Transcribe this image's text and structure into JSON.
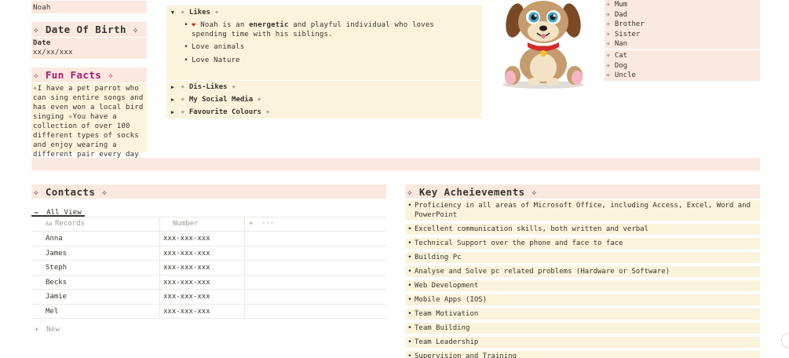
{
  "profile": {
    "name_value": "Noah",
    "dob_heading": "✧ Date Of Birth ✧",
    "dob_label": "Date",
    "dob_value": "xx/xx/xxx",
    "fun_heading": "✧ Fun Facts ✧",
    "fun_text": "✧I have a pet parrot who can sing entire songs and has even won a local bird singing ✧You have a collection of over 100 different types of socks and enjoy wearing a different pair every day"
  },
  "toggles": {
    "likes": "✧ Likes ✧",
    "likes_items": {
      "heart_icon": "❤",
      "intro_before": "Noah is an ",
      "intro_bold": "energetic",
      "intro_after": " and playful individual who loves spending time with his siblings.",
      "item2": "Love animals",
      "item3": "Love Nature"
    },
    "dislikes": "✧ Dis-Likes ✧",
    "social": "✧ My Social Media ✧",
    "colours": "✧ Favourite Colours ✧"
  },
  "family": {
    "group1": [
      "✧ Mum",
      "✧ Dad",
      "✧ Brother",
      "✧ Sister",
      "✧ Nan"
    ],
    "group2": [
      "✧ Cat",
      "✧ Dog",
      "✧ Uncle"
    ]
  },
  "contacts": {
    "heading": "✧ Contacts ✧",
    "view_tab": "All View",
    "col_records": "Records",
    "col_number": "Number",
    "rows": [
      {
        "name": "Anna",
        "number": "xxx-xxx-xxx"
      },
      {
        "name": "James",
        "number": "xxx-xxx-xxx"
      },
      {
        "name": "Steph",
        "number": "xxx-xxx-xxx"
      },
      {
        "name": "Becks",
        "number": "xxx-xxx-xxx"
      },
      {
        "name": "Jamie",
        "number": "xxx-xxx-xxx"
      },
      {
        "name": "Mel",
        "number": "xxx-xxx-xxx"
      }
    ],
    "new_label": "New",
    "add_label": "+",
    "more_label": "···",
    "aa_label": "Aa"
  },
  "achievements": {
    "heading": "✧ Key Acheievements ✧",
    "items": [
      "Proficiency in all areas of Microsoft Office, including Access, Excel, Word and PowerPoint",
      "Excellent communication skills, both written and verbal",
      "Technical Support over the phone and face to face",
      "Building Pc",
      "Analyse and Solve pc related problems (Hardware or Software)",
      "Web Development",
      "Mobile Apps (IOS)",
      "Team Motivation",
      "Team Building",
      "Team Leadership",
      "Supervision and Training"
    ]
  }
}
